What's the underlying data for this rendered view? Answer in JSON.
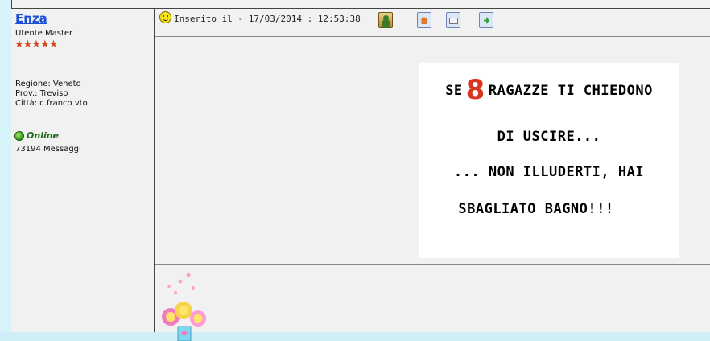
{
  "author": {
    "username": "Enza",
    "rank": "Utente Master",
    "stars": "★★★★★",
    "region": "Regione: Veneto",
    "province": "Prov.: Treviso",
    "city": "Città: c.franco vto",
    "status": "Online",
    "messages": "73194 Messaggi"
  },
  "post": {
    "inserted": "Inserito il - 17/03/2014 : 12:53:38",
    "icons": [
      "profile-icon",
      "home-icon",
      "email-icon",
      "quote-icon"
    ],
    "image_text": {
      "line1_before": "SE",
      "line1_number": "8",
      "line1_after": "RAGAZZE TI CHIEDONO",
      "line2": "DI USCIRE...",
      "line3": "... NON ILLUDERTI, HAI",
      "line4": "SBAGLIATO BAGNO!!!"
    }
  },
  "colors": {
    "background": "#f1f1f1",
    "link": "#1a4fd6",
    "online": "#1c6b16",
    "highlight_number": "#d8361e"
  }
}
